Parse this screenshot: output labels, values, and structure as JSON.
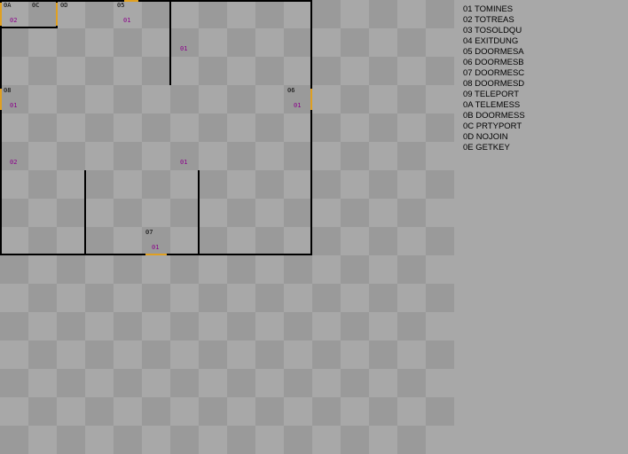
{
  "map": {
    "tile_codes": {
      "t0A": "0A",
      "t0C": "0C",
      "t0D": "0D",
      "t05": "05",
      "t08": "08",
      "t06": "06",
      "t07": "07"
    },
    "tile_counts": {
      "c_0A": "02",
      "c_05": "01",
      "c_mid_top": "01",
      "c_08": "01",
      "c_06": "01",
      "c_left_mid": "02",
      "c_center_mid": "01",
      "c_07": "01"
    }
  },
  "legend": {
    "items": [
      "01 TOMINES",
      "02 TOTREAS",
      "03 TOSOLDQU",
      "04 EXITDUNG",
      "05 DOORMESA",
      "06 DOORMESB",
      "07 DOORMESC",
      "08 DOORMESD",
      "09 TELEPORT",
      "0A TELEMESS",
      "0B DOORMESS",
      "0C PRTYPORT",
      "0D NOJOIN",
      "0E GETKEY"
    ]
  },
  "colors": {
    "background": "#a8a8a8",
    "checker_dark": "#9a9a9a",
    "wall": "#000000",
    "door": "#e0a020",
    "count_text": "#8b008b"
  }
}
